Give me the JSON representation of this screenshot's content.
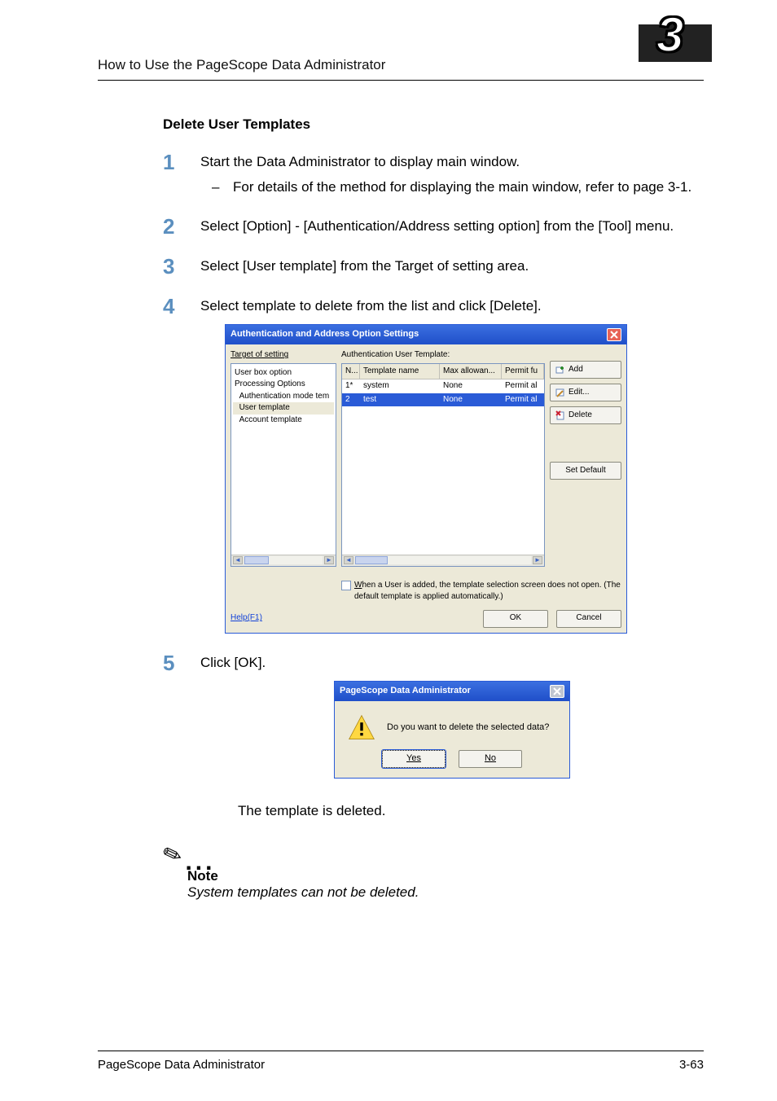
{
  "header": {
    "title": "How to Use the PageScope Data Administrator",
    "chapter_num": "3"
  },
  "section_title": "Delete User Templates",
  "steps": {
    "s1": {
      "text": "Start the Data Administrator to display main window.",
      "sub": "For details of the method for displaying the main window, refer to page 3-1."
    },
    "s2": "Select [Option] - [Authentication/Address setting option] from the [Tool] menu.",
    "s3": "Select [User template] from the Target of setting area.",
    "s4": "Select template to delete from the list and click [Delete].",
    "s5": "Click [OK]."
  },
  "dlg1": {
    "title": "Authentication and Address Option Settings",
    "target_label": "Target of setting",
    "tree": {
      "items": [
        "User box option",
        "Processing Options",
        "Authentication mode tem",
        "User template",
        "Account template"
      ],
      "selected_index": 3
    },
    "table": {
      "caption": "Authentication User Template:",
      "headers": [
        "N...",
        "Template name",
        "Max allowan...",
        "Permit fu"
      ],
      "rows": [
        {
          "n": "1*",
          "name": "system",
          "max": "None",
          "perm": "Permit al",
          "selected": false
        },
        {
          "n": "2",
          "name": "test",
          "max": "None",
          "perm": "Permit al",
          "selected": true
        }
      ]
    },
    "buttons": {
      "add": "Add",
      "edit": "Edit...",
      "delete": "Delete",
      "setdefault": "Set Default"
    },
    "checkbox_label": "When a User is added, the template selection screen does not open. (The default template is applied automatically.)",
    "help": "Help(F1)",
    "ok": "OK",
    "cancel": "Cancel"
  },
  "dlg2": {
    "title": "PageScope Data Administrator",
    "message": "Do you want to delete the selected data?",
    "yes": "Yes",
    "no": "No"
  },
  "after_text": "The template is deleted.",
  "note": {
    "head": "Note",
    "body": "System templates can not be deleted."
  },
  "footer": {
    "left": "PageScope Data Administrator",
    "right": "3-63"
  }
}
